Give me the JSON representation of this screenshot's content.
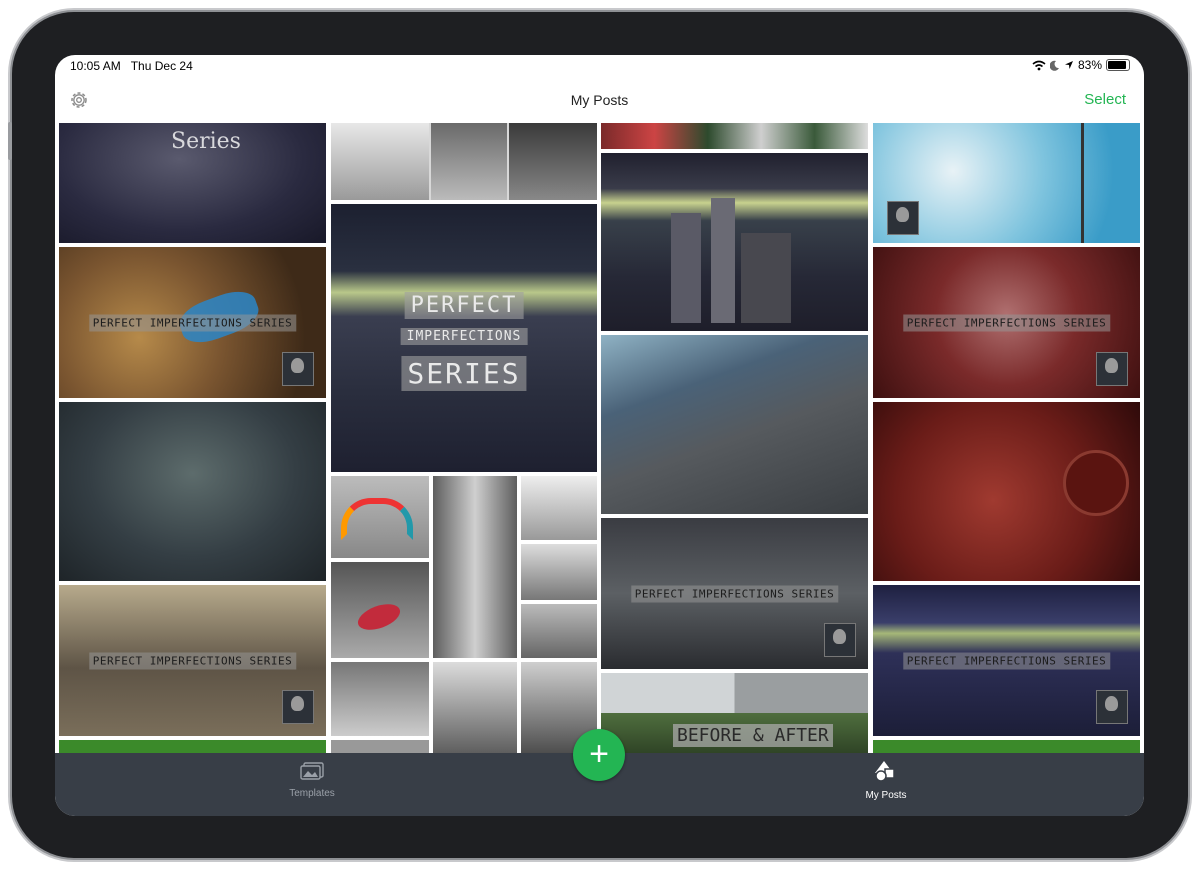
{
  "status_bar": {
    "time": "10:05 AM",
    "date": "Thu Dec 24",
    "battery": "83%",
    "battery_level": 0.83,
    "icons": [
      "wifi-icon",
      "moon-icon",
      "location-arrow-icon",
      "battery-icon"
    ]
  },
  "navbar": {
    "title": "My Posts",
    "select_label": "Select",
    "settings_icon": "gear-icon",
    "accent": "#23b553"
  },
  "posts": {
    "overlay_series": "Series",
    "overlay_perfect_imperfections": "PERFECT IMPERFECTIONS SERIES",
    "overlay_big_line1": "PERFECT",
    "overlay_big_line2": "IMPERFECTIONS",
    "overlay_big_line3": "SERIES",
    "overlay_before_after": "BEFORE & AFTER"
  },
  "tabbar": {
    "templates_label": "Templates",
    "my_posts_label": "My Posts",
    "add_label": "+",
    "background": "#383e47"
  }
}
